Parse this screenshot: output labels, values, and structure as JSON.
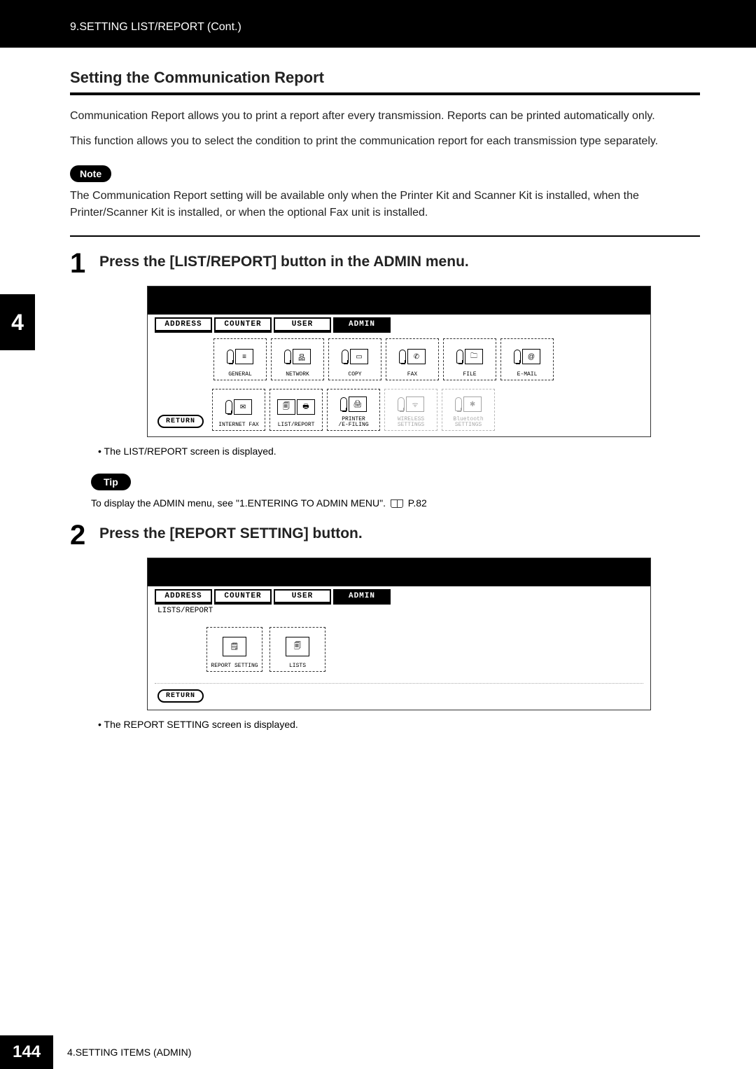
{
  "header": "9.SETTING LIST/REPORT (Cont.)",
  "section_title": "Setting the Communication Report",
  "intro_p1": "Communication Report allows you to print a report after every transmission.  Reports can be printed automatically only.",
  "intro_p2": "This function allows you to select the condition to print the communication report for each transmission type separately.",
  "note_label": "Note",
  "note_text": "The Communication Report setting will be available only when the Printer Kit and Scanner Kit is installed, when the Printer/Scanner Kit is installed, or when the optional Fax unit is installed.",
  "chapter_tab": "4",
  "step1": {
    "num": "1",
    "title": "Press the [LIST/REPORT] button in the ADMIN menu.",
    "result": "The LIST/REPORT screen is displayed."
  },
  "tip_label": "Tip",
  "tip_text_a": "To display the ADMIN menu, see \"1.ENTERING TO ADMIN MENU\".",
  "tip_ref": "P.82",
  "step2": {
    "num": "2",
    "title": "Press the [REPORT SETTING] button.",
    "result": "The REPORT SETTING screen is displayed."
  },
  "ui": {
    "tabs": {
      "address": "ADDRESS",
      "counter": "COUNTER",
      "user": "USER",
      "admin": "ADMIN"
    },
    "icons_row1": {
      "general": "GENERAL",
      "network": "NETWORK",
      "copy": "COPY",
      "fax": "FAX",
      "file": "FILE",
      "email": "E-MAIL"
    },
    "icons_row2": {
      "ifax": "INTERNET FAX",
      "list": "LIST/REPORT",
      "printer": "PRINTER\n/E-FILING",
      "wireless": "WIRELESS\nSETTINGS",
      "bluetooth": "Bluetooth\nSETTINGS"
    },
    "return": "RETURN",
    "lists_path": "LISTS/REPORT",
    "report_setting": "REPORT SETTING",
    "lists": "LISTS"
  },
  "footer": {
    "page": "144",
    "text": "4.SETTING ITEMS (ADMIN)"
  }
}
